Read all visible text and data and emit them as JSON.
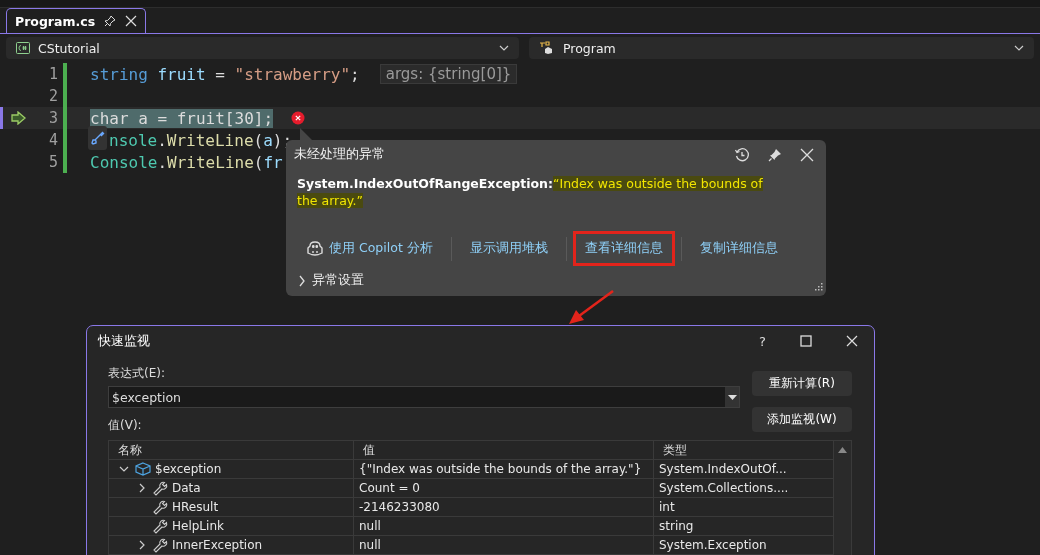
{
  "tabs": [
    {
      "label": "Program.cs",
      "selected": true
    }
  ],
  "nav": {
    "project": "CStutorial",
    "member": "Program"
  },
  "editor": {
    "lines": [
      {
        "number": "1",
        "current": false,
        "error": false,
        "tokens": [
          {
            "text": "string ",
            "kind": "keyword"
          },
          {
            "text": "fruit",
            "kind": "ident"
          },
          {
            "text": " = ",
            "kind": "plain"
          },
          {
            "text": "\"strawberry\"",
            "kind": "string"
          },
          {
            "text": ";",
            "kind": "plain"
          }
        ],
        "hint": "args: {string[0]}"
      },
      {
        "number": "2",
        "current": false,
        "error": false
      },
      {
        "number": "3",
        "current": true,
        "error": true,
        "tokens": [
          {
            "text": "char a = fruit[30];",
            "kind": "plain"
          }
        ]
      },
      {
        "number": "4",
        "current": false,
        "error": false,
        "quick_action": true,
        "tokens": [
          {
            "text": "nsole",
            "kind": "class"
          },
          {
            "text": ".",
            "kind": "plain"
          },
          {
            "text": "WriteLine",
            "kind": "method"
          },
          {
            "text": "(",
            "kind": "plain"
          },
          {
            "text": "a",
            "kind": "ident"
          },
          {
            "text": ");",
            "kind": "plain"
          }
        ]
      },
      {
        "number": "5",
        "current": false,
        "error": false,
        "tokens": [
          {
            "text": "Console",
            "kind": "class"
          },
          {
            "text": ".",
            "kind": "plain"
          },
          {
            "text": "WriteLine",
            "kind": "method"
          },
          {
            "text": "(",
            "kind": "plain"
          },
          {
            "text": "fr",
            "kind": "ident"
          }
        ]
      }
    ]
  },
  "exception_popup": {
    "title": "未经处理的异常",
    "exception_type": "System.IndexOutOfRangeException:",
    "message": "“Index was outside the bounds of the array.”",
    "actions": [
      {
        "label": "使用 Copilot 分析",
        "kind": "copilot",
        "highlighted": false
      },
      {
        "label": "显示调用堆栈",
        "kind": "plain",
        "highlighted": false
      },
      {
        "label": "查看详细信息",
        "kind": "plain",
        "highlighted": true
      },
      {
        "label": "复制详细信息",
        "kind": "plain",
        "highlighted": false
      }
    ],
    "settings": {
      "label": "异常设置",
      "expanded": false
    }
  },
  "quick_watch": {
    "title": "快速监视",
    "help": "?",
    "expression_label": "表达式(E):",
    "expression": "$exception",
    "value_label": "值(V):",
    "buttons": [
      "重新计算(R)",
      "添加监视(W)"
    ],
    "columns": [
      "名称",
      "值",
      "类型"
    ],
    "rows": [
      {
        "name": "$exception",
        "value": "{\"Index was outside the bounds of the array.\"}",
        "type": "System.IndexOutOf...",
        "kind": "object",
        "expanded": true,
        "children": [
          {
            "name": "Data",
            "value": "Count = 0",
            "type": "System.Collections....",
            "kind": "property",
            "expanded": false
          },
          {
            "name": "HResult",
            "value": "-2146233080",
            "type": "int",
            "kind": "property"
          },
          {
            "name": "HelpLink",
            "value": "null",
            "type": "string",
            "kind": "property"
          },
          {
            "name": "InnerException",
            "value": "null",
            "type": "System.Exception",
            "kind": "property",
            "expanded": false
          }
        ]
      }
    ]
  }
}
